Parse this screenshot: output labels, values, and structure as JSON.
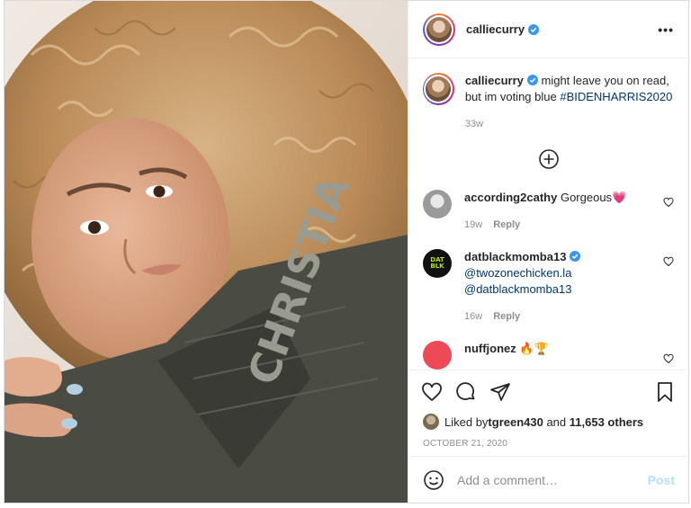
{
  "post": {
    "username": "calliecurry",
    "more_label": "•••"
  },
  "caption": {
    "username": "calliecurry",
    "text": "might leave you on read, but im voting blue ",
    "hashtag": "#BIDENHARRIS2020",
    "age": "33w"
  },
  "comments": [
    {
      "username": "according2cathy",
      "text": "Gorgeous💗",
      "age": "19w",
      "reply": "Reply"
    },
    {
      "username": "datblackmomba13",
      "mentions": [
        "@twozonechicken.la",
        "@datblackmomba13"
      ],
      "age": "16w",
      "reply": "Reply",
      "avatar_text": "DAT BLK"
    },
    {
      "username": "nuffjonez",
      "text": "🔥🏆"
    }
  ],
  "likes": {
    "prefix": "Liked by ",
    "user": "tgreen430",
    "middle": " and ",
    "others": "11,653 others"
  },
  "date": "OCTOBER 21, 2020",
  "add_comment": {
    "placeholder": "Add a comment…",
    "post_label": "Post"
  },
  "photo": {
    "shirt_text": "CHRISTIA"
  },
  "colors": {
    "verified": "#3897f0",
    "link": "#00376b",
    "post_disabled": "#b2dffc",
    "heart_avatar": "#ed4956"
  },
  "icons": [
    "verified-icon",
    "more-icon",
    "load-more-icon",
    "heart-icon",
    "comment-icon",
    "share-icon",
    "bookmark-icon",
    "emoji-icon"
  ]
}
